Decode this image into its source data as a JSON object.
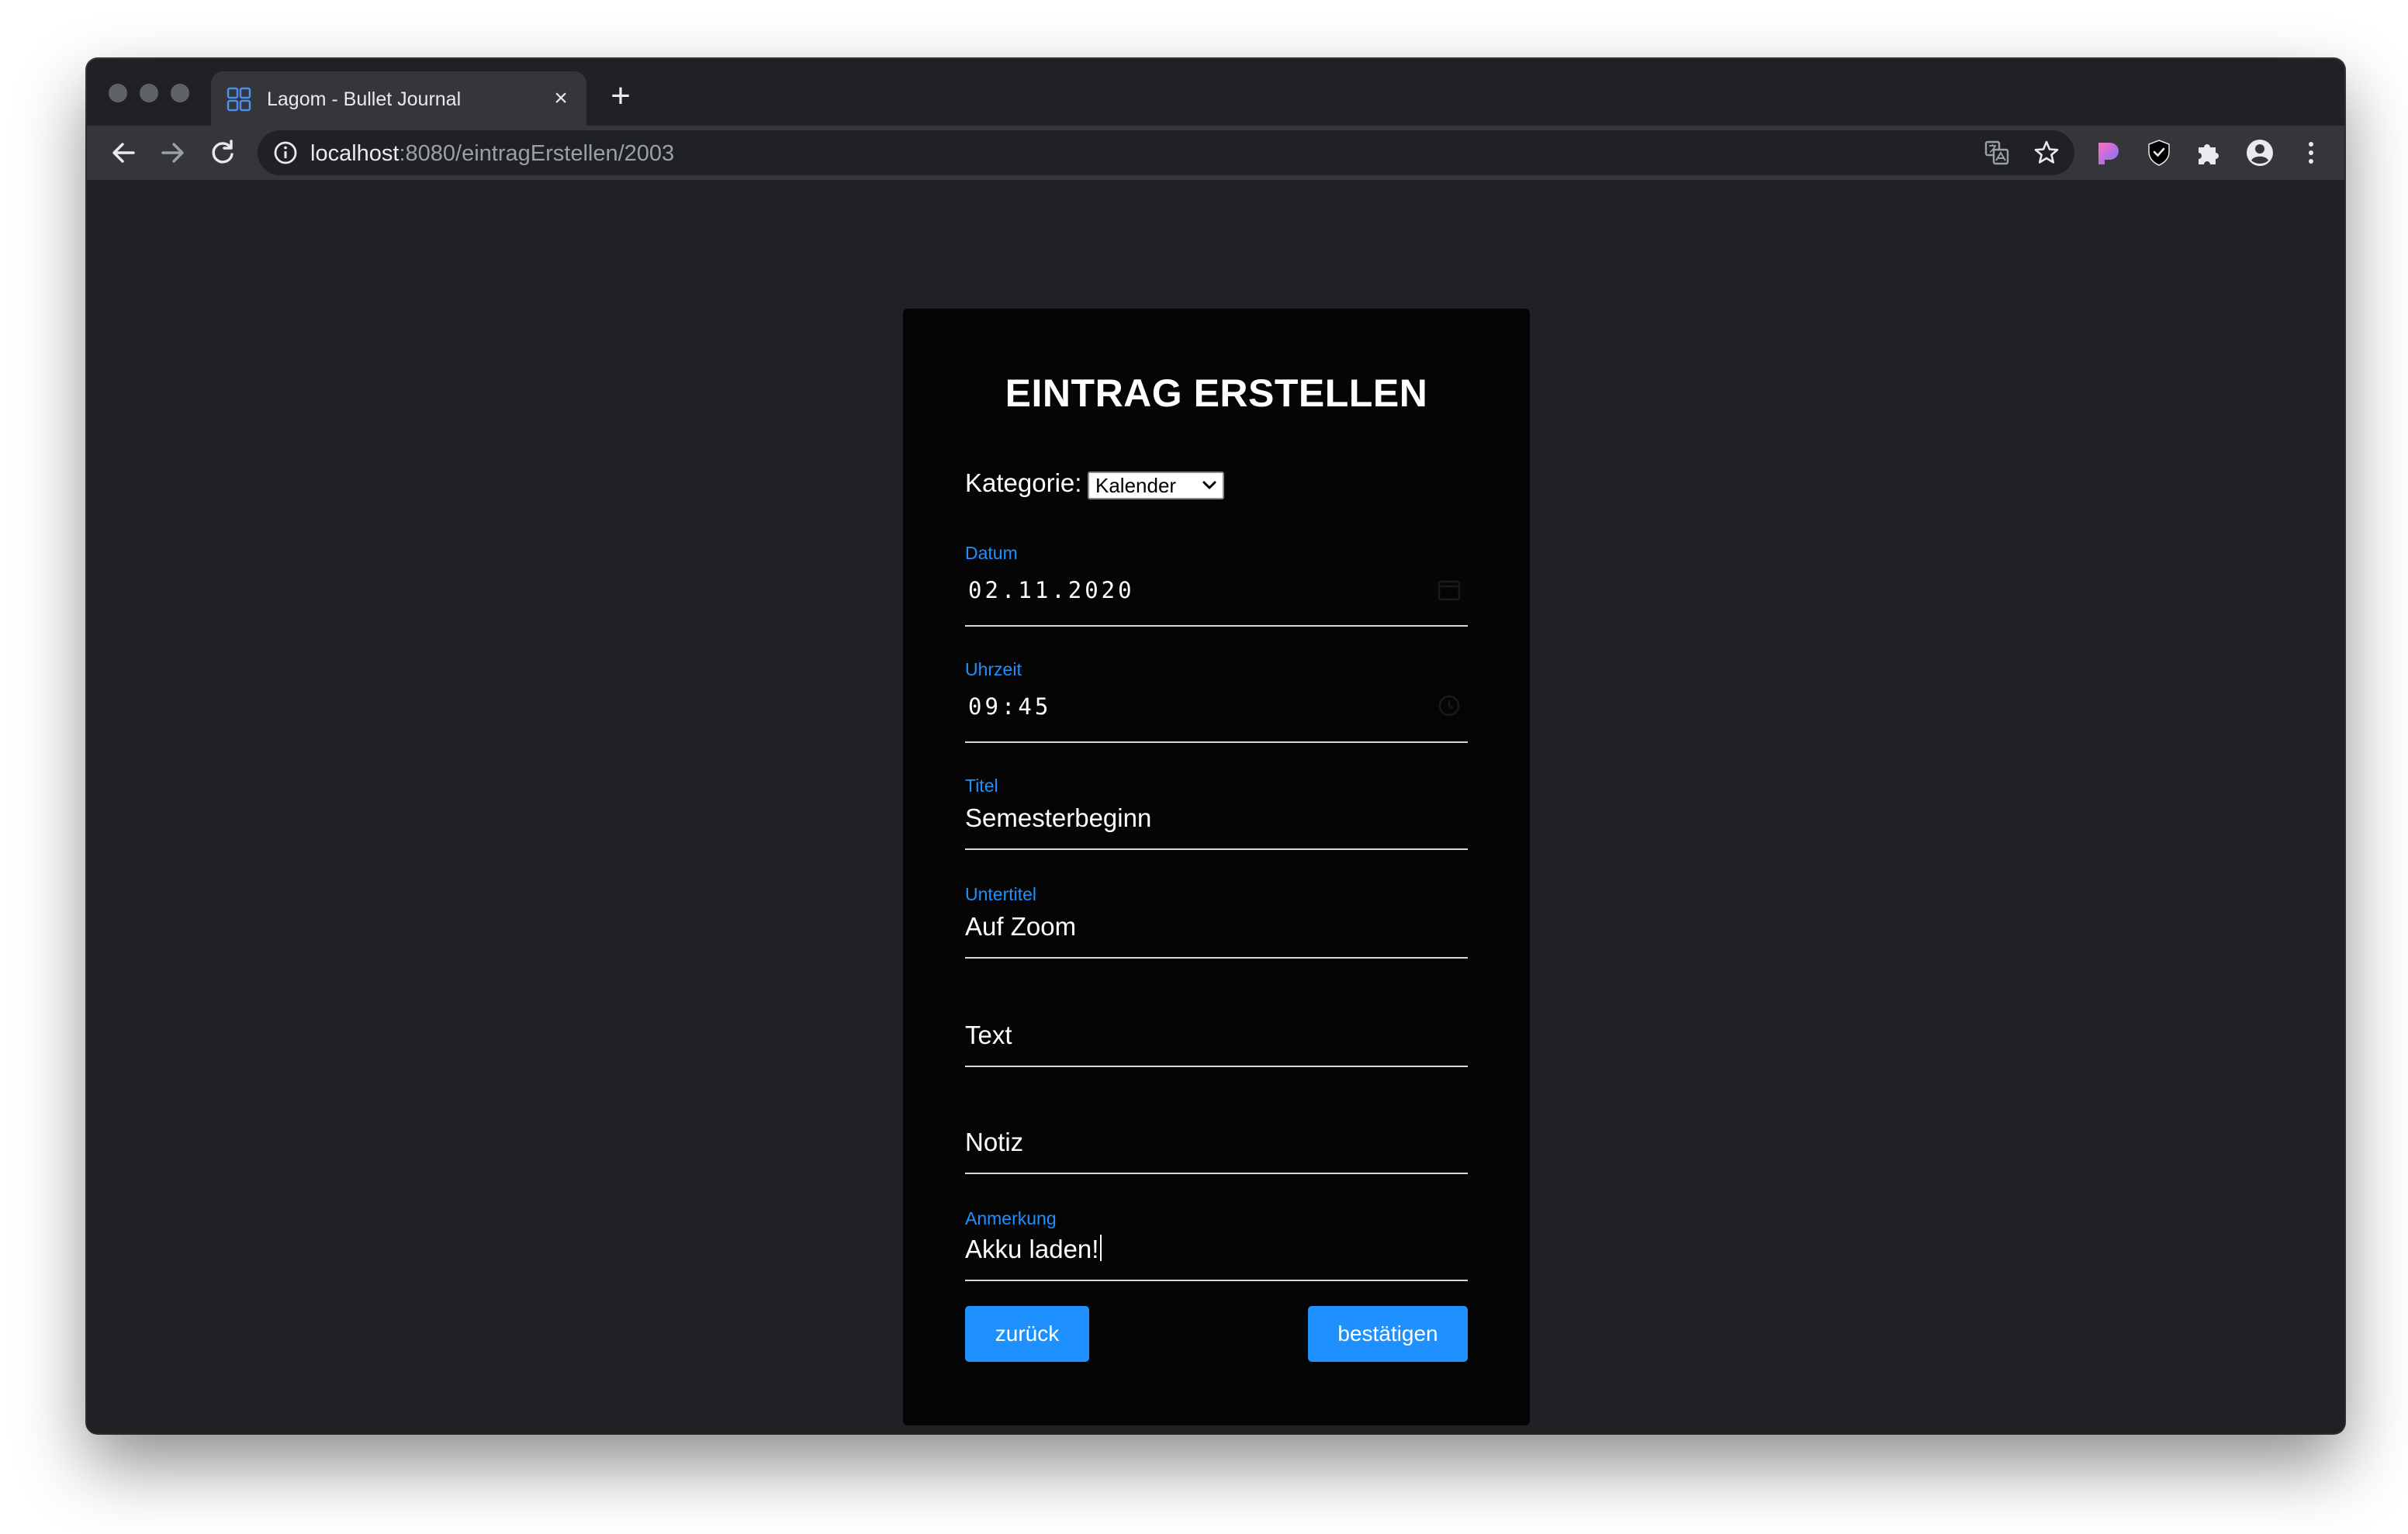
{
  "browser": {
    "tab_title": "Lagom - Bullet Journal",
    "tab_close": "×",
    "new_tab": "+",
    "url_host": "localhost",
    "url_rest": ":8080/eintragErstellen/2003"
  },
  "form": {
    "title": "EINTRAG ERSTELLEN",
    "kategorie_label": "Kategorie:",
    "kategorie_value": "Kalender",
    "datum_label": "Datum",
    "datum_value": "02.11.2020",
    "uhrzeit_label": "Uhrzeit",
    "uhrzeit_value": "09:45",
    "titel_label": "Titel",
    "titel_value": "Semesterbeginn",
    "untertitel_label": "Untertitel",
    "untertitel_value": "Auf Zoom",
    "text_placeholder": "Text",
    "notiz_placeholder": "Notiz",
    "anmerkung_label": "Anmerkung",
    "anmerkung_value": "Akku laden!",
    "back_button": "zurück",
    "confirm_button": "bestätigen"
  },
  "colors": {
    "accent": "#1e90ff",
    "page_bg": "#202124",
    "card_bg": "#050505"
  },
  "icons": {
    "tab_favicon": "grid-icon",
    "back": "arrow-left-icon",
    "forward": "arrow-right-icon",
    "reload": "reload-icon",
    "site_info": "info-icon",
    "translate": "translate-icon",
    "bookmark": "star-icon",
    "extensions": "puzzle-icon",
    "profile": "account-icon",
    "menu": "more-vert-icon",
    "date_picker": "calendar-icon",
    "time_picker": "clock-icon"
  }
}
